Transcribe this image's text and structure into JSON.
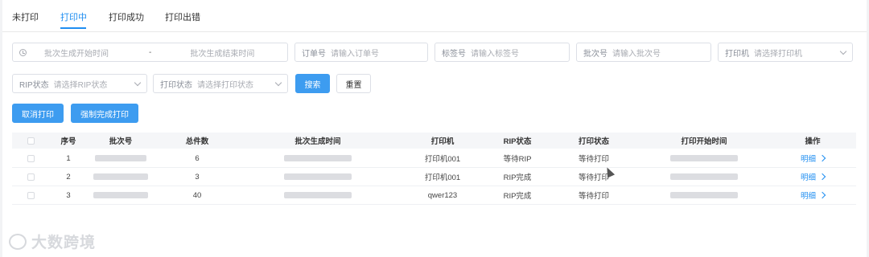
{
  "tabs": [
    {
      "label": "未打印"
    },
    {
      "label": "打印中"
    },
    {
      "label": "打印成功"
    },
    {
      "label": "打印出错"
    }
  ],
  "filters": {
    "start_time_placeholder": "批次生成开始时间",
    "range_separator": "-",
    "end_time_placeholder": "批次生成结束时间",
    "order_label": "订单号",
    "order_placeholder": "请输入订单号",
    "tag_label": "标签号",
    "tag_placeholder": "请输入标签号",
    "batch_label": "批次号",
    "batch_placeholder": "请输入批次号",
    "printer_label": "打印机",
    "printer_placeholder": "请选择打印机",
    "rip_label": "RIP状态",
    "rip_placeholder": "请选择RIP状态",
    "print_status_label": "打印状态",
    "print_status_placeholder": "请选择打印状态",
    "search_button": "搜索",
    "reset_button": "重置"
  },
  "actions": {
    "cancel_print": "取消打印",
    "force_complete": "强制完成打印"
  },
  "table": {
    "headers": [
      "序号",
      "批次号",
      "总件数",
      "批次生成时间",
      "打印机",
      "RIP状态",
      "打印状态",
      "打印开始时间",
      "操作"
    ],
    "rows": [
      {
        "index": "1",
        "total": "6",
        "printer": "打印机001",
        "rip": "等待RIP",
        "status": "等待打印",
        "action": "明细"
      },
      {
        "index": "2",
        "total": "3",
        "printer": "打印机001",
        "rip": "RIP完成",
        "status": "等待打印",
        "action": "明细"
      },
      {
        "index": "3",
        "total": "40",
        "printer": "qwer123",
        "rip": "RIP完成",
        "status": "等待打印",
        "action": "明细"
      }
    ]
  },
  "watermark": "大数跨境",
  "icons": [
    "clock-icon",
    "chevron-down-icon",
    "chevron-right-icon",
    "mouse-cursor-icon"
  ]
}
